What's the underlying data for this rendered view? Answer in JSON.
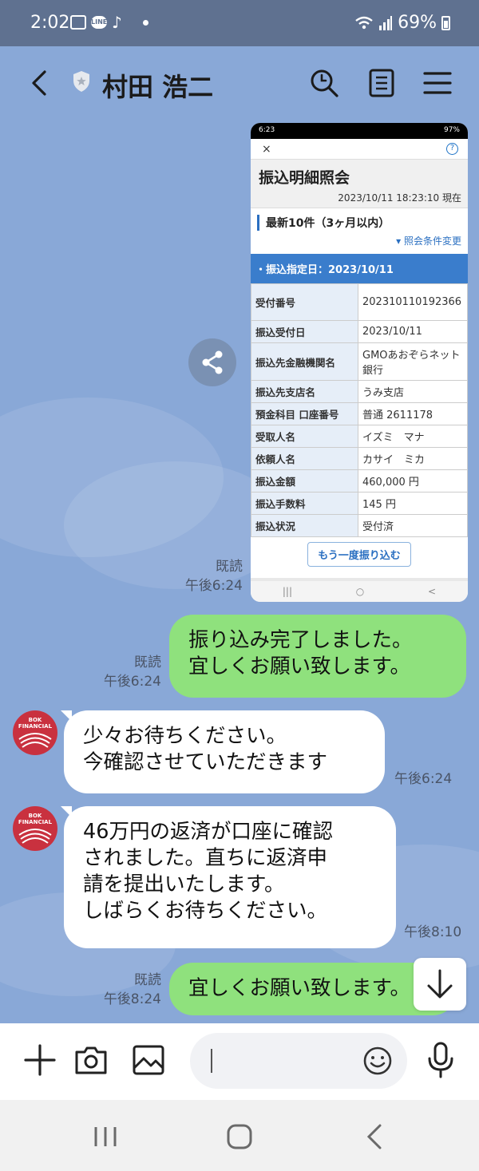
{
  "status_bar": {
    "time": "2:02",
    "line_badge": "LINE",
    "tiktok_glyph": "♪",
    "battery": "69%"
  },
  "header": {
    "title": "村田 浩二"
  },
  "shared_screenshot": {
    "status_time": "6:23",
    "status_right": "97%",
    "close_glyph": "×",
    "help_glyph": "?",
    "title": "振込明細照会",
    "datetime": "2023/10/11 18:23:10 現在",
    "section_title": "最新10件（3ヶ月以内）",
    "condition_link": "照会条件変更",
    "transfer_date": "振込指定日：2023/10/11",
    "rows": [
      {
        "label": "受付番号",
        "value": "202310110192366"
      },
      {
        "label": "振込受付日",
        "value": "2023/10/11"
      },
      {
        "label": "振込先金融機関名",
        "value": "GMOあおぞらネット銀行"
      },
      {
        "label": "振込先支店名",
        "value": "うみ支店"
      },
      {
        "label": "預金科目 口座番号",
        "value": "普通 2611178"
      },
      {
        "label": "受取人名",
        "value": "イズミ　マナ"
      },
      {
        "label": "依頼人名",
        "value": "カサイ　ミカ"
      },
      {
        "label": "振込金額",
        "value": "460,000 円"
      },
      {
        "label": "振込手数料",
        "value": "145 円"
      },
      {
        "label": "振込状況",
        "value": "受付済"
      }
    ],
    "resend_button": "もう一度振り込む",
    "nav": [
      "|||",
      "○",
      "<"
    ]
  },
  "messages": [
    {
      "read": "既読",
      "time": "午後6:24"
    },
    {
      "read": "既読",
      "time": "午後6:24",
      "lines": [
        "振り込み完了しました。",
        "宜しくお願い致します。"
      ]
    },
    {
      "time": "午後6:24",
      "lines": [
        "少々お待ちください。",
        "今確認させていただきます"
      ]
    },
    {
      "time": "午後8:10",
      "lines": [
        "46万円の返済が口座に確認",
        "されました。直ちに返済申",
        "請を提出いたします。",
        "しばらくお待ちください。"
      ]
    },
    {
      "read": "既読",
      "time": "午後8:24",
      "lines": [
        "宜しくお願い致します。"
      ]
    }
  ],
  "avatar_text": [
    "BOK",
    "FINANCIAL"
  ],
  "colors": {
    "chat_bg": "#89a8d7",
    "outgoing": "#8fe17d",
    "incoming": "#ffffff",
    "status_bar": "#5f7190"
  }
}
